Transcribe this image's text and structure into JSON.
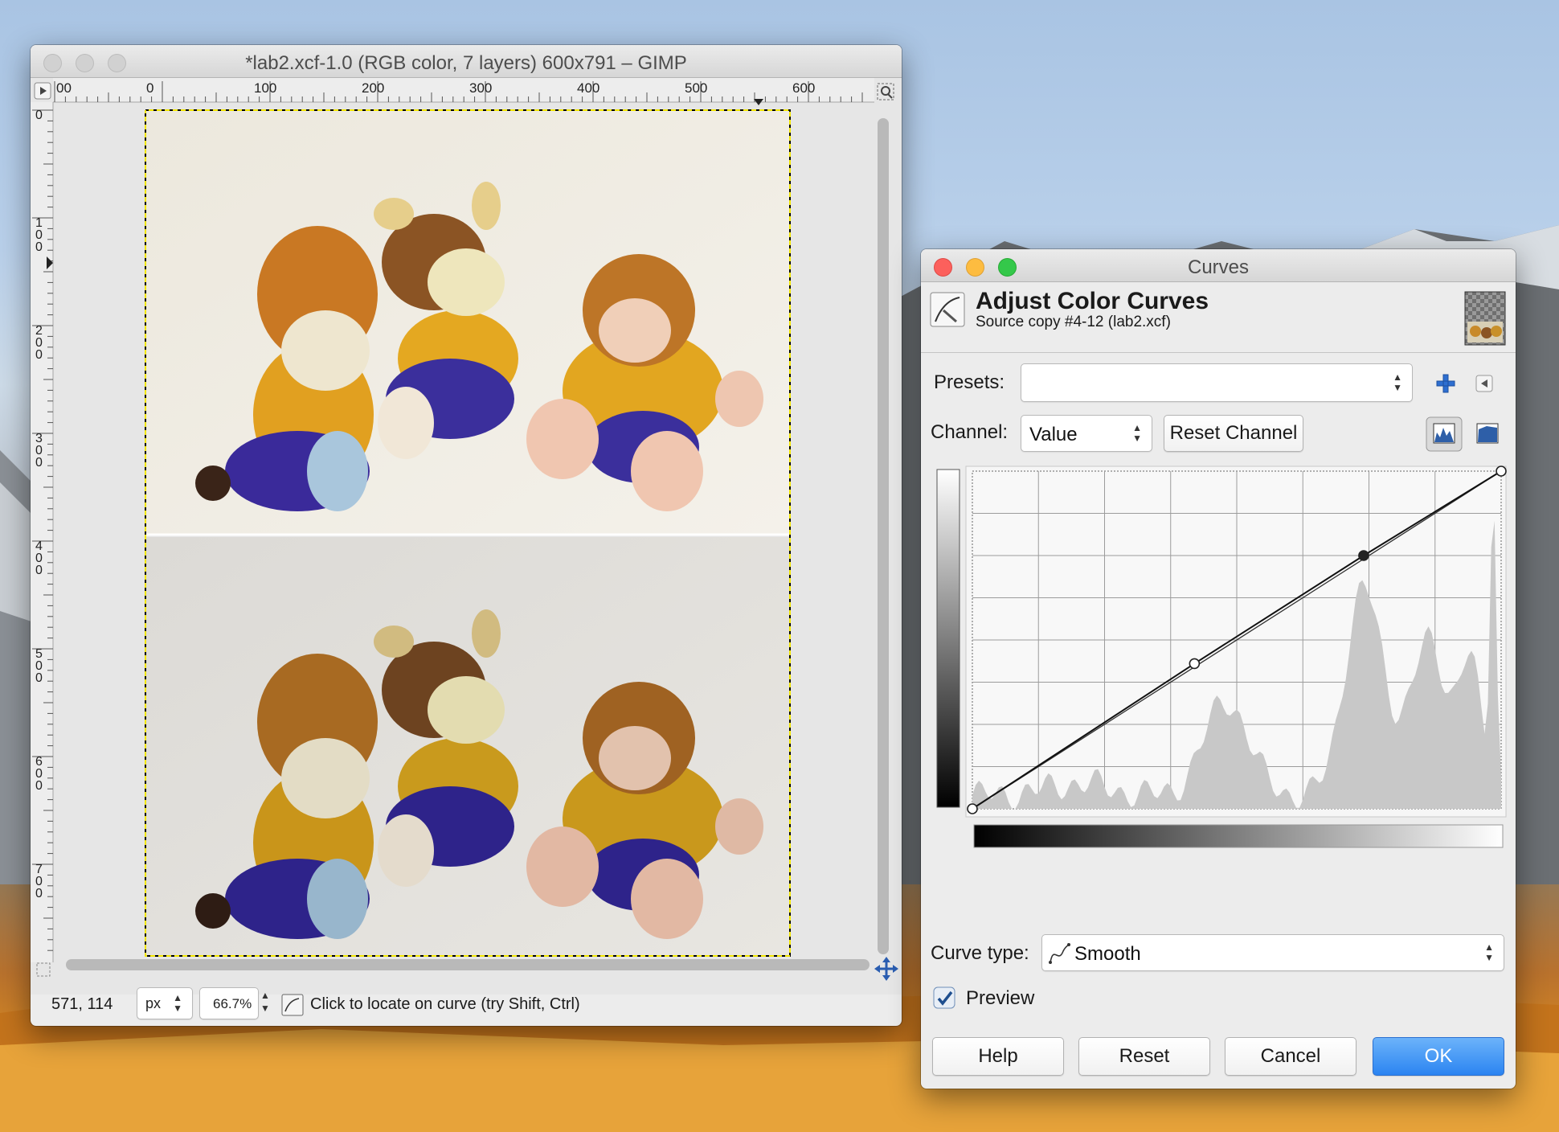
{
  "gimp_window": {
    "title": "*lab2.xcf-1.0 (RGB color, 7 layers) 600x791 – GIMP",
    "ruler_h_labels": [
      "00",
      "0",
      "100",
      "200",
      "300",
      "400",
      "500",
      "600"
    ],
    "ruler_v_labels": [
      "0",
      "100",
      "200",
      "300",
      "400",
      "500",
      "600",
      "700"
    ],
    "status": {
      "coords": "571, 114",
      "unit": "px",
      "zoom": "66.7%",
      "message": "Click to locate on curve (try Shift, Ctrl)"
    }
  },
  "curves_dialog": {
    "title": "Curves",
    "heading": "Adjust Color Curves",
    "subheading": "Source copy #4-12 (lab2.xcf)",
    "presets_label": "Presets:",
    "presets_value": "",
    "channel_label": "Channel:",
    "channel_value": "Value",
    "reset_channel_label": "Reset Channel",
    "curve_type_label": "Curve type:",
    "curve_type_value": "Smooth",
    "preview_label": "Preview",
    "preview_checked": true,
    "buttons": {
      "help": "Help",
      "reset": "Reset",
      "cancel": "Cancel",
      "ok": "OK"
    },
    "curve_points": [
      [
        0,
        0
      ],
      [
        0.42,
        0.43
      ],
      [
        0.74,
        0.75
      ],
      [
        1.0,
        1.0
      ]
    ],
    "accent_color": "#2b84f1"
  },
  "icons": [
    "play-icon",
    "zoom-fit-icon",
    "plus-icon",
    "collapse-arrow-icon",
    "linear-histogram-icon",
    "log-histogram-icon",
    "curve-tool-icon",
    "navigate-icon",
    "checkmark-icon"
  ]
}
